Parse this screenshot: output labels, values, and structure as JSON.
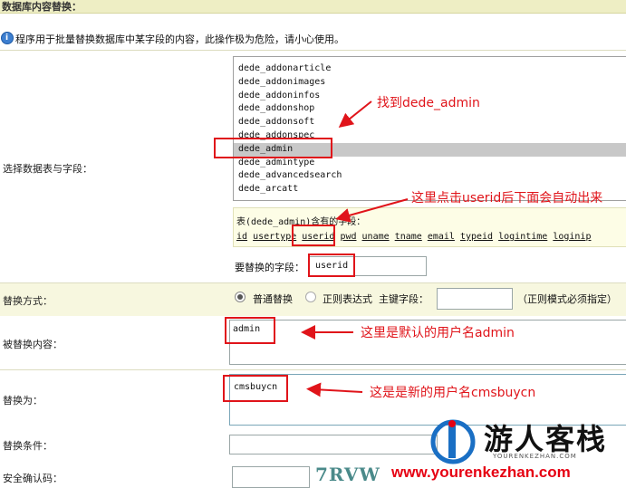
{
  "header": {
    "title": "数据库内容替换："
  },
  "notice": {
    "text": "程序用于批量替换数据库中某字段的内容，此操作极为危险，请小心使用。"
  },
  "select_table": {
    "label": "选择数据表与字段：",
    "options": [
      "dede_addonarticle",
      "dede_addonimages",
      "dede_addoninfos",
      "dede_addonshop",
      "dede_addonsoft",
      "dede_addonspec",
      "dede_admin",
      "dede_admintype",
      "dede_advancedsearch",
      "dede_arcatt"
    ],
    "selected": "dede_admin"
  },
  "fields": {
    "title": "表(dede_admin)含有的字段：",
    "items": [
      "id",
      "usertype",
      "userid",
      "pwd",
      "uname",
      "tname",
      "email",
      "typeid",
      "logintime",
      "loginip"
    ]
  },
  "replace_field": {
    "label": "要替换的字段：",
    "value": "userid"
  },
  "replace_mode": {
    "label": "替换方式：",
    "normal": "普通替换",
    "regex": "正则表达式",
    "key_field": "主键字段：",
    "hint": "（正则模式必须指定）"
  },
  "old_content": {
    "label": "被替换内容：",
    "value": "admin"
  },
  "new_content": {
    "label": "替换为：",
    "value": "cmsbuycn"
  },
  "condition": {
    "label": "替换条件："
  },
  "captcha": {
    "label": "安全确认码：",
    "image_text": "7RVW"
  },
  "annotations": {
    "find_admin": "找到dede_admin",
    "click_userid": "这里点击userid后下面会自动出来",
    "default_user": "这里是默认的用户名admin",
    "new_user": "这是是新的用户名cmsbuycn"
  },
  "watermark": {
    "name": "游人客栈",
    "sub": "YOURENKEZHAN.COM",
    "url": "www.yourenkezhan.com"
  },
  "colors": {
    "annotation": "#e0141a",
    "band": "#f7f7df",
    "header": "#eeeec4",
    "watermark_red": "#e60012",
    "watermark_blue": "#1a6fc4"
  }
}
